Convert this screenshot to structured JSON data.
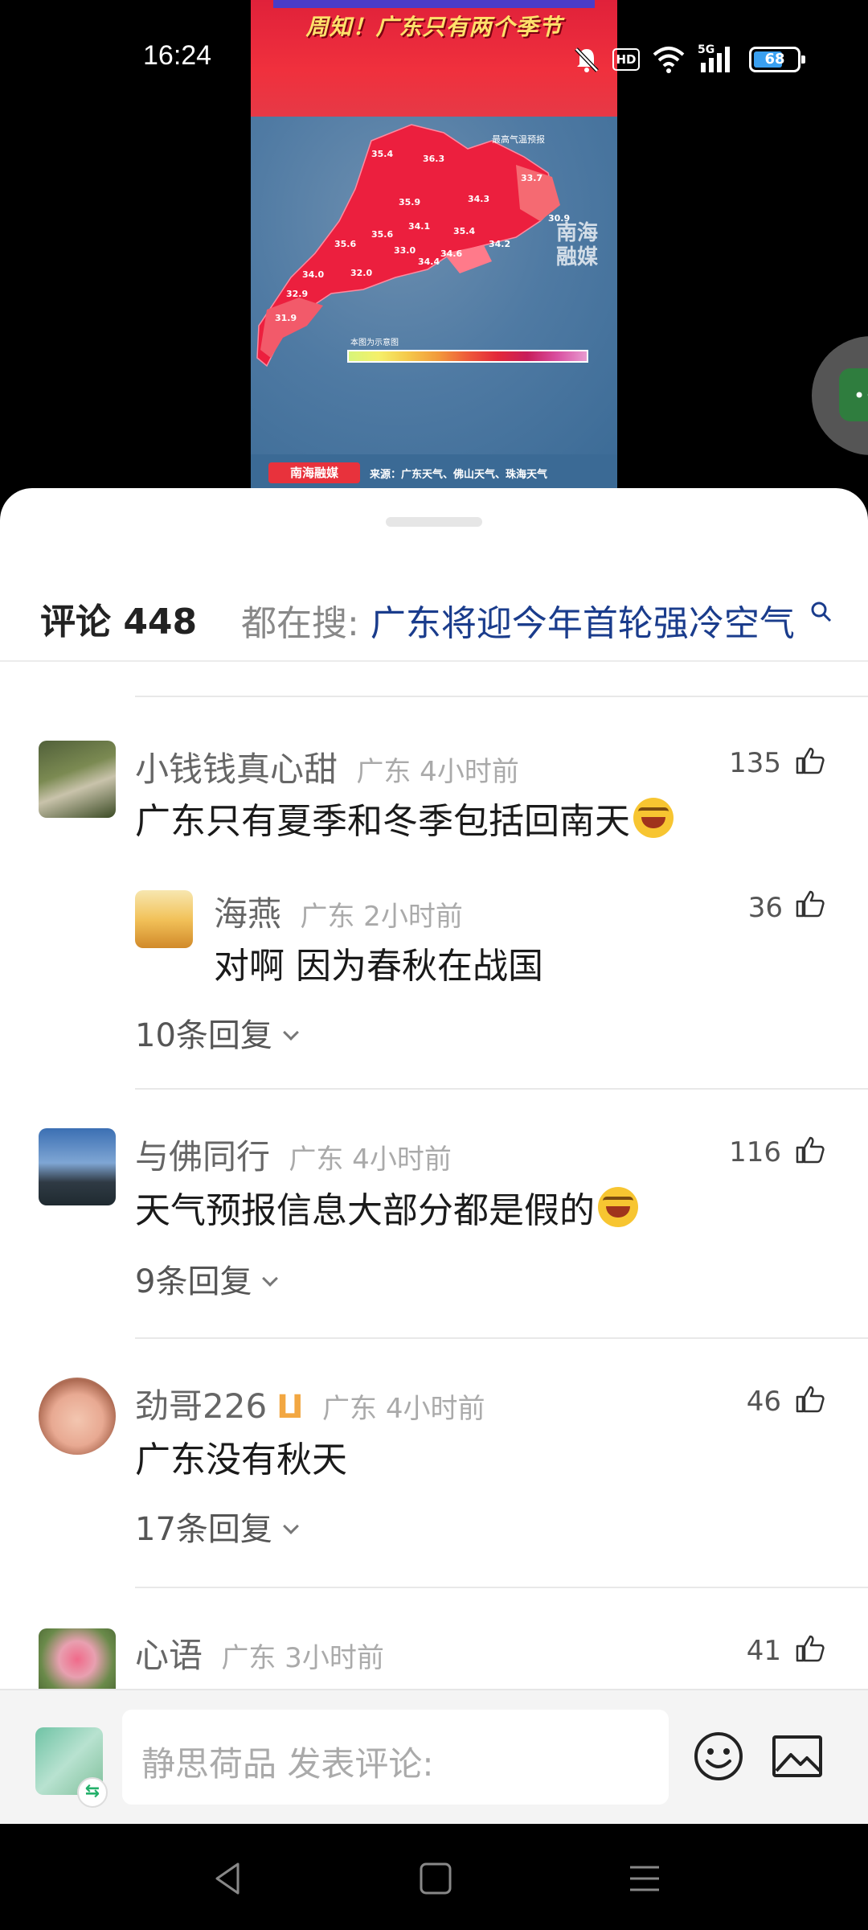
{
  "status_bar": {
    "time": "16:24",
    "battery": "68",
    "battery_level": 0.68,
    "icons": [
      "bell-muted-icon",
      "hd-icon",
      "wifi-icon",
      "5g-signal-icon",
      "battery-icon"
    ],
    "hd_label": "HD",
    "network_label": "5G"
  },
  "video": {
    "banner_title": "周知！广东只有两个季节",
    "legend_title": "最高气温预报",
    "legend_label": "本图为示意图",
    "source": "来源：广东天气、佛山天气、珠海天气",
    "logo": "南海融媒",
    "watermark": "南海融媒",
    "temperatures": [
      "35.4",
      "36.3",
      "33.7",
      "35.9",
      "34.3",
      "30.9",
      "34.1",
      "35.6",
      "35.4",
      "35.6",
      "33.0",
      "34.4",
      "34.6",
      "34.2",
      "34.0",
      "32.0",
      "32.9",
      "31.9"
    ]
  },
  "sheet": {
    "comments_label": "评论 448",
    "hot_search_label": "都在搜:",
    "hot_search_text": "广东将迎今年首轮强冷空气"
  },
  "comments": [
    {
      "name": "小钱钱真心甜",
      "location_time": "广东 4小时前",
      "text": "广东只有夏季和冬季包括回南天",
      "likes": "135",
      "reply": {
        "name": "海燕",
        "location_time": "广东 2小时前",
        "text": "对啊 因为春秋在战国",
        "likes": "36"
      },
      "replies_label": "10条回复"
    },
    {
      "name": "与佛同行",
      "location_time": "广东 4小时前",
      "text": "天气预报信息大部分都是假的",
      "likes": "116",
      "replies_label": "9条回复"
    },
    {
      "name": "劲哥226",
      "location_time": "广东 4小时前",
      "text": "广东没有秋天",
      "likes": "46",
      "replies_label": "17条回复"
    },
    {
      "name": "心语",
      "location_time": "广东 3小时前",
      "likes": "41"
    }
  ],
  "input_bar": {
    "placeholder": "静思荷品 发表评论:"
  },
  "colors": {
    "link": "#1a3c8c",
    "accent_red": "#e8323c",
    "vip": "#f2a742"
  }
}
